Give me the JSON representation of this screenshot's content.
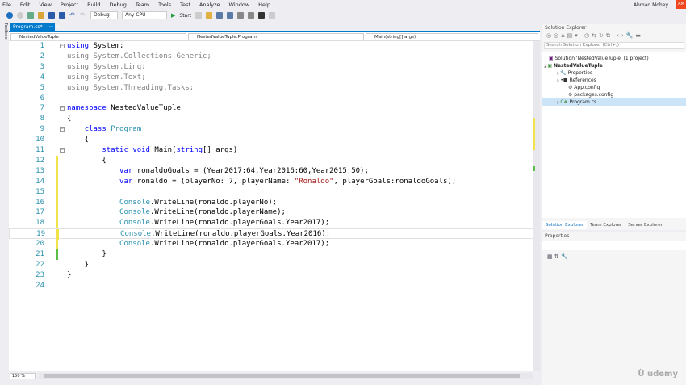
{
  "menu": [
    "File",
    "Edit",
    "View",
    "Project",
    "Build",
    "Debug",
    "Team",
    "Tools",
    "Test",
    "Analyze",
    "Window",
    "Help"
  ],
  "user": {
    "name": "Ahmad Mohey",
    "initials": "AM"
  },
  "toolbar": {
    "config": "Debug",
    "platform": "Any CPU",
    "start": "Start"
  },
  "toolbox_label": "Toolbox",
  "tab": {
    "label": "Program.cs*"
  },
  "nav": {
    "project": "NestedValueTuple",
    "class": "NestedValueTuple.Program",
    "member": "Main(string[] args)"
  },
  "editor": {
    "zoom": "150 %",
    "lines": [
      [
        [
          "kw",
          "using"
        ],
        [
          "pl",
          " System;"
        ]
      ],
      [
        [
          "gray",
          "using System.Collections.Generic;"
        ]
      ],
      [
        [
          "gray",
          "using System.Linq;"
        ]
      ],
      [
        [
          "gray",
          "using System.Text;"
        ]
      ],
      [
        [
          "gray",
          "using System.Threading.Tasks;"
        ]
      ],
      [],
      [
        [
          "kw",
          "namespace"
        ],
        [
          "pl",
          " NestedValueTuple"
        ]
      ],
      [
        [
          "pl",
          "{"
        ]
      ],
      [
        [
          "pl",
          "    "
        ],
        [
          "kw",
          "class"
        ],
        [
          "pl",
          " "
        ],
        [
          "ty",
          "Program"
        ]
      ],
      [
        [
          "pl",
          "    {"
        ]
      ],
      [
        [
          "pl",
          "        "
        ],
        [
          "kw",
          "static void"
        ],
        [
          "pl",
          " Main("
        ],
        [
          "kw",
          "string"
        ],
        [
          "pl",
          "[] args)"
        ]
      ],
      [
        [
          "pl",
          "        {"
        ]
      ],
      [
        [
          "pl",
          "            "
        ],
        [
          "kw",
          "var"
        ],
        [
          "pl",
          " ronaldoGoals = (Year2017:64,Year2016:60,Year2015:50);"
        ]
      ],
      [
        [
          "pl",
          "            "
        ],
        [
          "kw",
          "var"
        ],
        [
          "pl",
          " ronaldo = (playerNo: 7, playerName: "
        ],
        [
          "str",
          "\"Ronaldo\""
        ],
        [
          "pl",
          ", playerGoals:ronaldoGoals);"
        ]
      ],
      [],
      [
        [
          "pl",
          "            "
        ],
        [
          "ty",
          "Console"
        ],
        [
          "pl",
          ".WriteLine(ronaldo.playerNo);"
        ]
      ],
      [
        [
          "pl",
          "            "
        ],
        [
          "ty",
          "Console"
        ],
        [
          "pl",
          ".WriteLine(ronaldo.playerName);"
        ]
      ],
      [
        [
          "pl",
          "            "
        ],
        [
          "ty",
          "Console"
        ],
        [
          "pl",
          ".WriteLine(ronaldo.playerGoals.Year2017);"
        ]
      ],
      [
        [
          "pl",
          "            "
        ],
        [
          "ty",
          "Console"
        ],
        [
          "pl",
          ".WriteLine(ronaldo.playerGoals.Year2016);"
        ]
      ],
      [
        [
          "pl",
          "            "
        ],
        [
          "ty",
          "Console"
        ],
        [
          "pl",
          ".WriteLine(ronaldo.playerGoals.Year2017);"
        ]
      ],
      [
        [
          "pl",
          "        }"
        ]
      ],
      [
        [
          "pl",
          "    }"
        ]
      ],
      [
        [
          "pl",
          "}"
        ]
      ],
      []
    ]
  },
  "solution_explorer": {
    "title": "Solution Explorer",
    "search_placeholder": "Search Solution Explorer (Ctrl+;)",
    "items": [
      {
        "label": "Solution 'NestedValueTuple' (1 project)"
      },
      {
        "label": "NestedValueTuple"
      },
      {
        "label": "Properties"
      },
      {
        "label": "References"
      },
      {
        "label": "App.config"
      },
      {
        "label": "packages.config"
      },
      {
        "label": "Program.cs"
      }
    ],
    "tabs": [
      "Solution Explorer",
      "Team Explorer",
      "Server Explorer"
    ]
  },
  "properties": {
    "title": "Properties"
  },
  "watermark": "Udemy"
}
